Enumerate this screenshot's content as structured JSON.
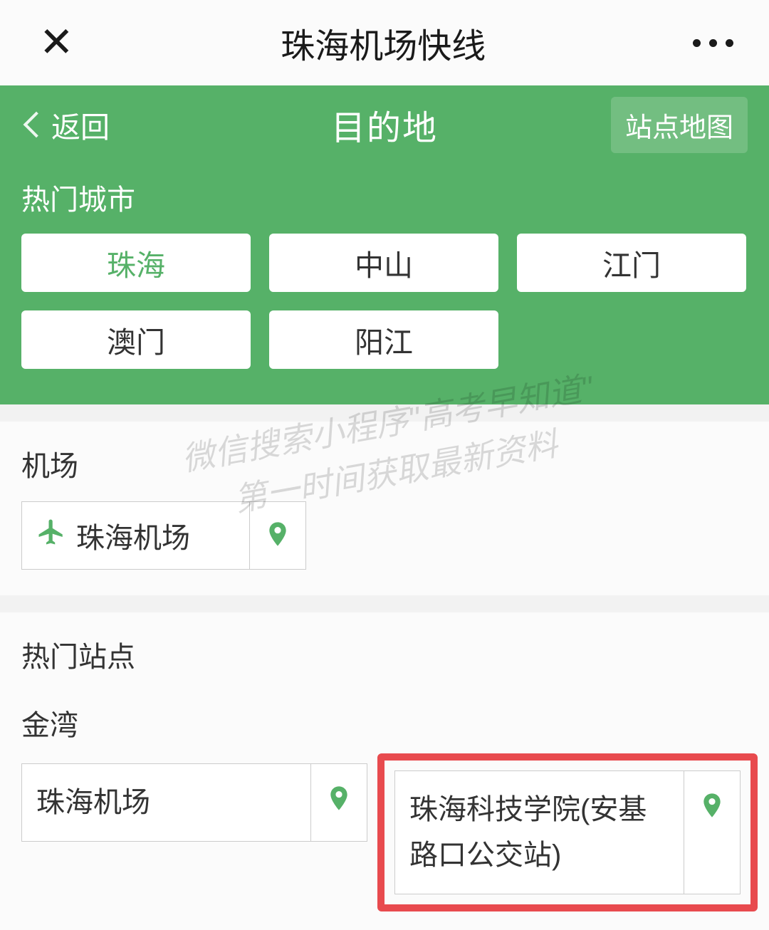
{
  "top": {
    "title": "珠海机场快线"
  },
  "nav": {
    "back": "返回",
    "title": "目的地",
    "map_btn": "站点地图"
  },
  "hot_cities": {
    "label": "热门城市",
    "items": [
      "珠海",
      "中山",
      "江门",
      "澳门",
      "阳江"
    ],
    "selected_index": 0
  },
  "airport_section": {
    "label": "机场",
    "item": "珠海机场"
  },
  "stations_section": {
    "label": "热门站点",
    "district": "金湾",
    "items": [
      {
        "name": "珠海机场",
        "highlighted": false
      },
      {
        "name": "珠海科技学院(安基路口公交站)",
        "highlighted": true
      }
    ]
  },
  "watermark": {
    "line1": "微信搜索小程序\"高考早知道\"",
    "line2": "第一时间获取最新资料"
  }
}
